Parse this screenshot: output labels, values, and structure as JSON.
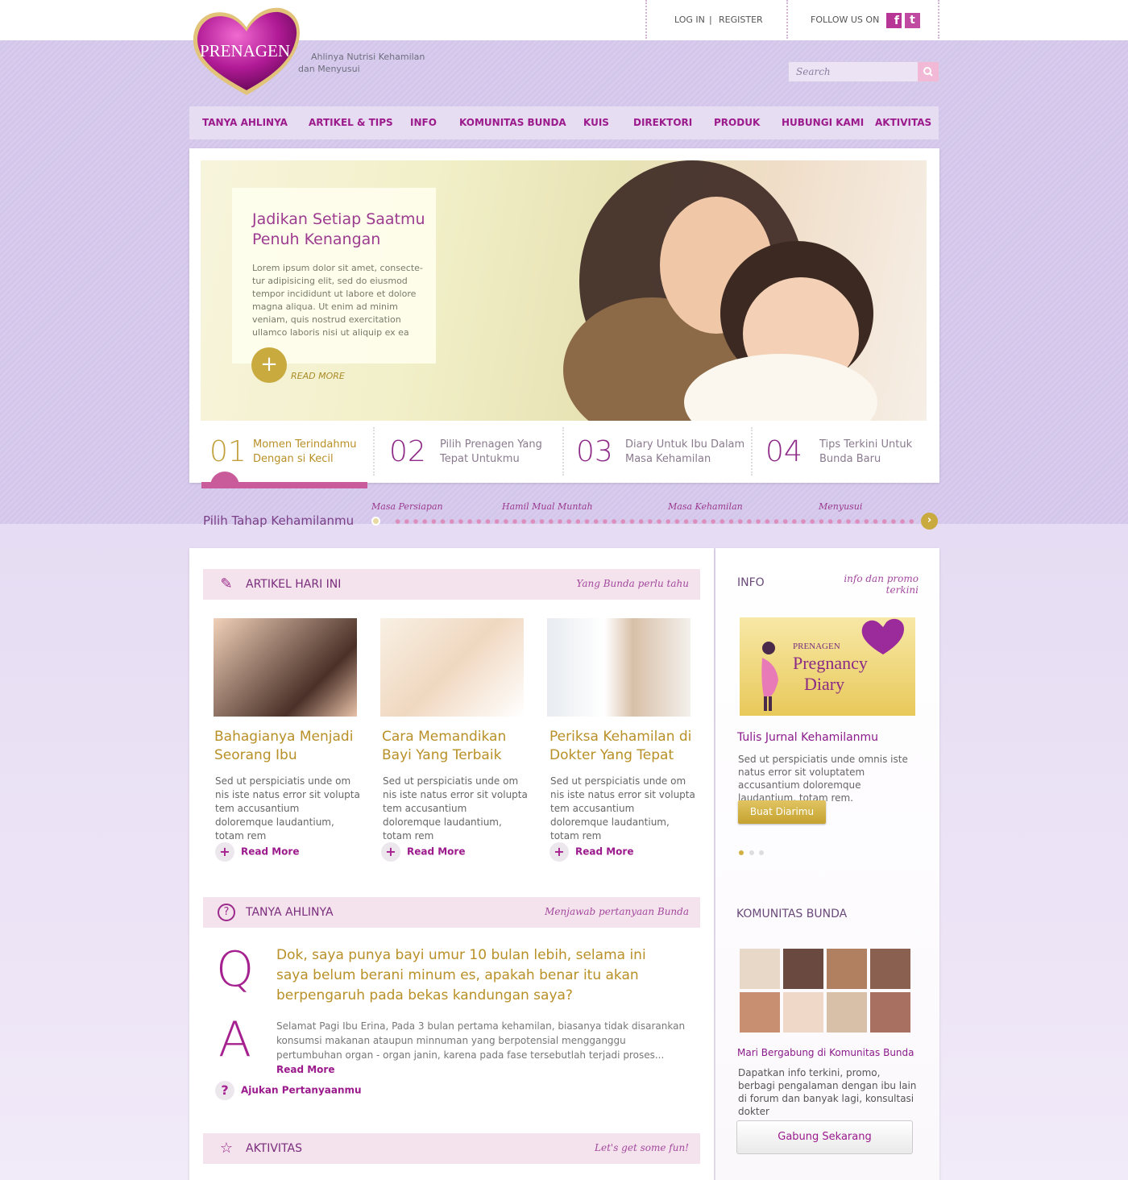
{
  "header": {
    "login": "LOG IN",
    "sep": "|",
    "register": "REGISTER",
    "follow": "FOLLOW US ON",
    "facebook_icon": "facebook-icon",
    "twitter_icon": "twitter-icon"
  },
  "brand": {
    "logo": "PRENAGEN",
    "tagline_1": "Ahlinya Nutrisi Kehamilan",
    "tagline_2": "dan Menyusui",
    "color_primary": "#9b1a8c",
    "color_gold": "#b89027"
  },
  "search": {
    "placeholder": "Search"
  },
  "nav": [
    "TANYA AHLINYA",
    "ARTIKEL & TIPS",
    "INFO",
    "KOMUNITAS BUNDA",
    "KUIS",
    "DIREKTORI",
    "PRODUK",
    "HUBUNGI KAMI",
    "AKTIVITAS"
  ],
  "hero": {
    "title": "Jadikan Setiap Saatmu Penuh Kenangan",
    "text": "Lorem ipsum dolor sit amet, consecte-tur adipisicing elit, sed do eiusmod tempor incididunt ut labore et dolore magna aliqua. Ut enim ad minim veniam, quis nostrud exercitation ullamco laboris nisi ut aliquip ex ea",
    "plus": "+",
    "read_more": "READ MORE"
  },
  "slides": [
    {
      "num": "01",
      "l1": "Momen Terindahmu",
      "l2": "Dengan si Kecil"
    },
    {
      "num": "02",
      "l1": "Pilih Prenagen Yang",
      "l2": "Tepat Untukmu"
    },
    {
      "num": "03",
      "l1": "Diary Untuk Ibu Dalam",
      "l2": "Masa Kehamilan"
    },
    {
      "num": "04",
      "l1": "Tips Terkini Untuk",
      "l2": "Bunda Baru"
    }
  ],
  "stage": {
    "title": "Pilih Tahap Kehamilanmu",
    "labels": [
      "Masa Persiapan",
      "Hamil Mual Muntah",
      "Masa Kehamilan",
      "Menyusui"
    ],
    "next_icon": "chevron-right-icon"
  },
  "artikel": {
    "title": "ARTIKEL HARI INI",
    "subtitle": "Yang Bunda perlu tahu",
    "items": [
      {
        "title": "Bahagianya Menjadi Seorang Ibu",
        "text": "Sed ut perspiciatis unde om nis iste natus error sit volupta tem accusantium doloremque laudantium, totam rem",
        "more": "Read More"
      },
      {
        "title": "Cara Memandikan Bayi Yang Terbaik",
        "text": "Sed ut perspiciatis unde om nis iste natus error sit volupta tem accusantium doloremque laudantium, totam rem",
        "more": "Read More"
      },
      {
        "title": "Periksa Kehamilan di Dokter Yang Tepat",
        "text": "Sed ut perspiciatis unde om nis iste natus error sit volupta tem accusantium doloremque laudantium, totam rem",
        "more": "Read More"
      }
    ]
  },
  "tanya": {
    "title": "TANYA  AHLINYA",
    "subtitle": "Menjawab pertanyaan Bunda",
    "q": "Q",
    "a": "A",
    "question": "Dok, saya punya bayi umur 10 bulan lebih, selama ini saya belum berani minum es, apakah benar itu akan berpengaruh pada bekas kandungan saya?",
    "answer": "Selamat Pagi Ibu Erina, Pada 3 bulan pertama kehamilan, biasanya tidak disarankan konsumsi makanan ataupun minnuman yang berpotensial mengganggu pertumbuhan organ - organ janin, karena pada fase tersebutlah terjadi proses...",
    "more": "Read More",
    "ask": "Ajukan Pertanyaanmu"
  },
  "aktivitas": {
    "title": "AKTIVITAS",
    "subtitle": "Let's get some fun!"
  },
  "info": {
    "title": "INFO",
    "subtitle_1": "info dan promo",
    "subtitle_2": "terkini",
    "banner_brand": "PRENAGEN",
    "banner_1": "Pregnancy",
    "banner_2": "Diary",
    "item_title": "Tulis Jurnal Kehamilanmu",
    "item_text": "Sed ut perspiciatis unde omnis iste natus error sit voluptatem accusantium doloremque laudantium, totam rem.",
    "button": "Buat Diarimu"
  },
  "komunitas": {
    "title": "KOMUNITAS BUNDA",
    "item_title": "Mari Bergabung di Komunitas Bunda",
    "item_text": "Dapatkan info terkini, promo, berbagi pengalaman dengan ibu lain di forum dan banyak lagi, konsultasi dokter",
    "button": "Gabung Sekarang"
  }
}
